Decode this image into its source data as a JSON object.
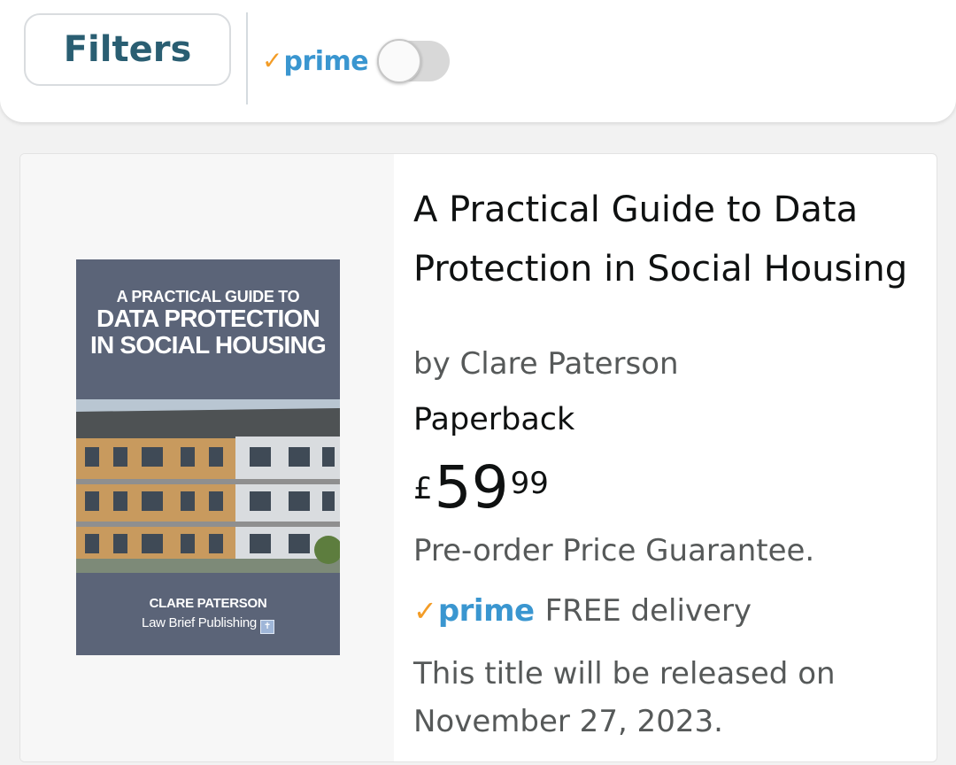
{
  "filter_bar": {
    "filters_label": "Filters",
    "prime_check": "✓",
    "prime_word": "prime",
    "prime_toggle_on": false
  },
  "result": {
    "cover": {
      "line1": "A PRACTICAL GUIDE TO",
      "line2": "DATA PROTECTION",
      "line3": "IN SOCIAL HOUSING",
      "author": "CLARE PATERSON",
      "publisher": "Law Brief Publishing"
    },
    "title": "A Practical Guide to Data Protection in Social Housing",
    "author": "by Clare Paterson",
    "format": "Paperback",
    "price": {
      "symbol": "£",
      "whole": "59",
      "fraction": "99"
    },
    "price_note": "Pre-order Price Guarantee.",
    "delivery": {
      "prime_check": "✓",
      "prime_word": "prime",
      "text": "FREE delivery"
    },
    "release_note": "This title will be released on November 27, 2023."
  },
  "colors": {
    "filters_text": "#2a5e72",
    "prime_check": "#f39c26",
    "prime_word": "#3a96d0",
    "cover_bg": "#5b6478",
    "muted_text": "#565959"
  }
}
